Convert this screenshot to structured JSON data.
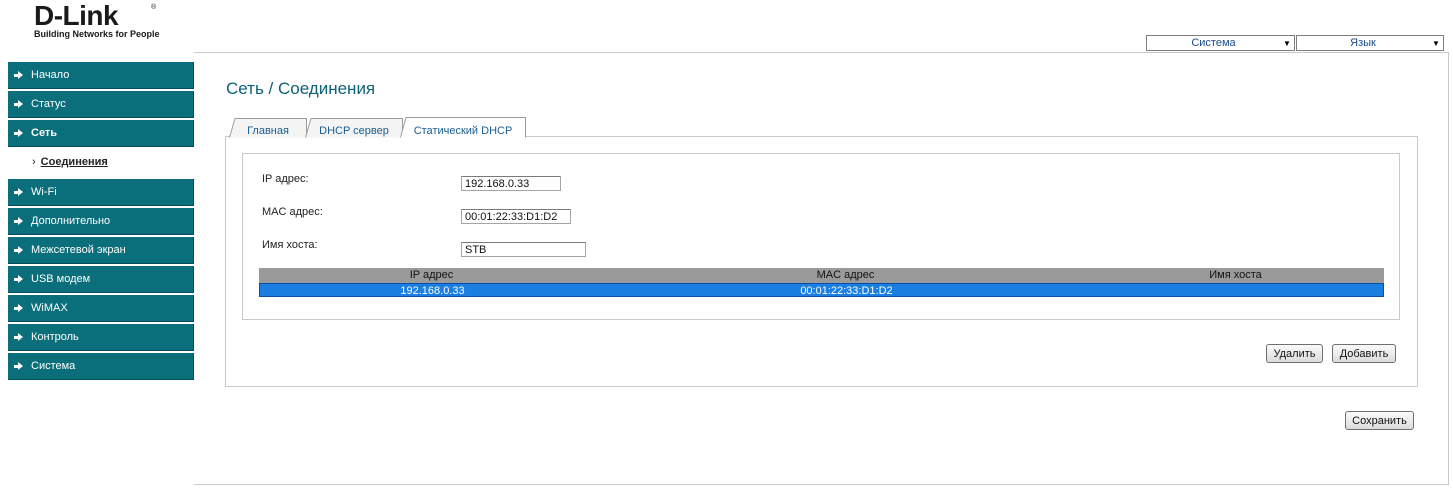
{
  "brand": {
    "name": "D-Link",
    "tagline": "Building Networks for People",
    "reg_mark": "®"
  },
  "top_bar": {
    "system_select": "Система",
    "language_select": "Язык"
  },
  "sidebar": {
    "items": [
      {
        "label": "Начало"
      },
      {
        "label": "Статус"
      },
      {
        "label": "Сеть",
        "active": true
      },
      {
        "label": "Wi-Fi"
      },
      {
        "label": "Дополнительно"
      },
      {
        "label": "Межсетевой экран"
      },
      {
        "label": "USB модем"
      },
      {
        "label": "WiMAX"
      },
      {
        "label": "Контроль"
      },
      {
        "label": "Система"
      }
    ],
    "subitems": [
      {
        "label": "Соединения",
        "active": true
      }
    ],
    "subitem_marker": "›"
  },
  "page": {
    "title": "Сеть / Соединения"
  },
  "tabs": [
    {
      "label": "Главная"
    },
    {
      "label": "DHCP сервер"
    },
    {
      "label": "Статический DHCP",
      "active": true
    }
  ],
  "form": {
    "ip_label": "IP адрес:",
    "ip_value": "192.168.0.33",
    "mac_label": "MAC адрес:",
    "mac_value": "00:01:22:33:D1:D2",
    "host_label": "Имя хоста:",
    "host_value": "STB"
  },
  "table": {
    "headers": [
      "IP адрес",
      "MAC адрес",
      "Имя хоста"
    ],
    "rows": [
      [
        "192.168.0.33",
        "00:01:22:33:D1:D2",
        ""
      ]
    ]
  },
  "buttons": {
    "delete": "Удалить",
    "add": "Добавить",
    "save": "Сохранить"
  },
  "colors": {
    "menu_bg": "#0a6e7b",
    "title": "#0f6178",
    "selected_row": "#1a7fe0",
    "table_header": "#9a9a9a"
  },
  "icons": {
    "menu_arrow": "arrow-right-icon",
    "select_arrow": "triangle-down-icon"
  }
}
